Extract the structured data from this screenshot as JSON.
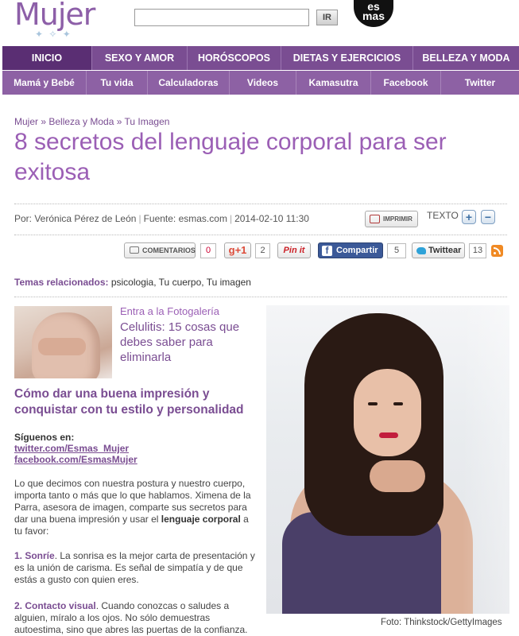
{
  "header": {
    "logo": "Mujer",
    "logo_stars": "✦ ✧ ✦",
    "search_placeholder": "",
    "search_button": "IR",
    "partner_logo_top": "es",
    "partner_logo_bottom": "mas"
  },
  "nav_primary": [
    {
      "label": "INICIO",
      "active": true
    },
    {
      "label": "SEXO Y AMOR"
    },
    {
      "label": "HORÓSCOPOS"
    },
    {
      "label": "DIETAS Y EJERCICIOS"
    },
    {
      "label": "BELLEZA Y MODA"
    }
  ],
  "nav_secondary": [
    {
      "label": "Mamá y Bebé"
    },
    {
      "label": "Tu vida"
    },
    {
      "label": "Calculadoras"
    },
    {
      "label": "Videos"
    },
    {
      "label": "Kamasutra"
    },
    {
      "label": "Facebook"
    },
    {
      "label": "Twitter"
    }
  ],
  "article": {
    "breadcrumb": [
      "Mujer",
      "Belleza y Moda",
      "Tu Imagen"
    ],
    "breadcrumb_sep": " » ",
    "title": "8 secretos del lenguaje corporal para ser exitosa",
    "author": "Por: Verónica Pérez de León",
    "source": "Fuente: esmas.com",
    "date": "2014-02-10 11:30",
    "meta_sep": "|",
    "print_label": "IMPRIMIR",
    "text_size_label": "TEXTO",
    "text_plus": "+",
    "text_minus": "−"
  },
  "share": {
    "comments_label": "COMENTARIOS",
    "comments_count": "0",
    "gplus_label": "+1",
    "gplus_count": "2",
    "pinterest_label": "Pin it",
    "facebook_label": "Compartir",
    "facebook_count": "5",
    "twitter_label": "Twittear",
    "twitter_count": "13"
  },
  "temas": {
    "label": "Temas relacionados:",
    "items": [
      "psicologia",
      "Tu cuerpo",
      "Tu imagen"
    ]
  },
  "gallery": {
    "label": "Entra a la Fotogalería",
    "title": "Celulitis: 15 cosas que debes saber para eliminarla"
  },
  "subhead": "Cómo dar una buena impresión y conquistar con tu estilo y personalidad",
  "follow": {
    "label": "Síguenos en:",
    "twitter": "twitter.com/Esmas_Mujer",
    "facebook": "facebook.com/EsmasMujer"
  },
  "body": {
    "intro_a": "Lo que decimos con nuestra postura y nuestro cuerpo, importa tanto o más que lo que hablamos. Ximena de la Parra, asesora de imagen, comparte sus secretos para dar una buena impresión y usar el ",
    "intro_bold": "lenguaje corporal",
    "intro_b": " a tu favor:",
    "p1_bold": "1. Sonríe",
    "p1_text": ". La sonrisa es la mejor carta de presentación y es la unión de carisma. Es señal de simpatía y de que estás a gusto con quien eres.",
    "p2_bold": "2. Contacto visual",
    "p2_text": ". Cuando conozcas o saludes a alguien, míralo a los ojos. No sólo demuestras autoestima, sino que abres las puertas de la confianza."
  },
  "photo_credit": "Foto: Thinkstock/GettyImages",
  "colors": {
    "brand_purple": "#7a4d92",
    "title_purple": "#9b5fb5",
    "nav_active": "#5a2e73",
    "facebook_blue": "#3b5998",
    "pinterest_red": "#cb2027",
    "gplus_red": "#dd4b39"
  }
}
